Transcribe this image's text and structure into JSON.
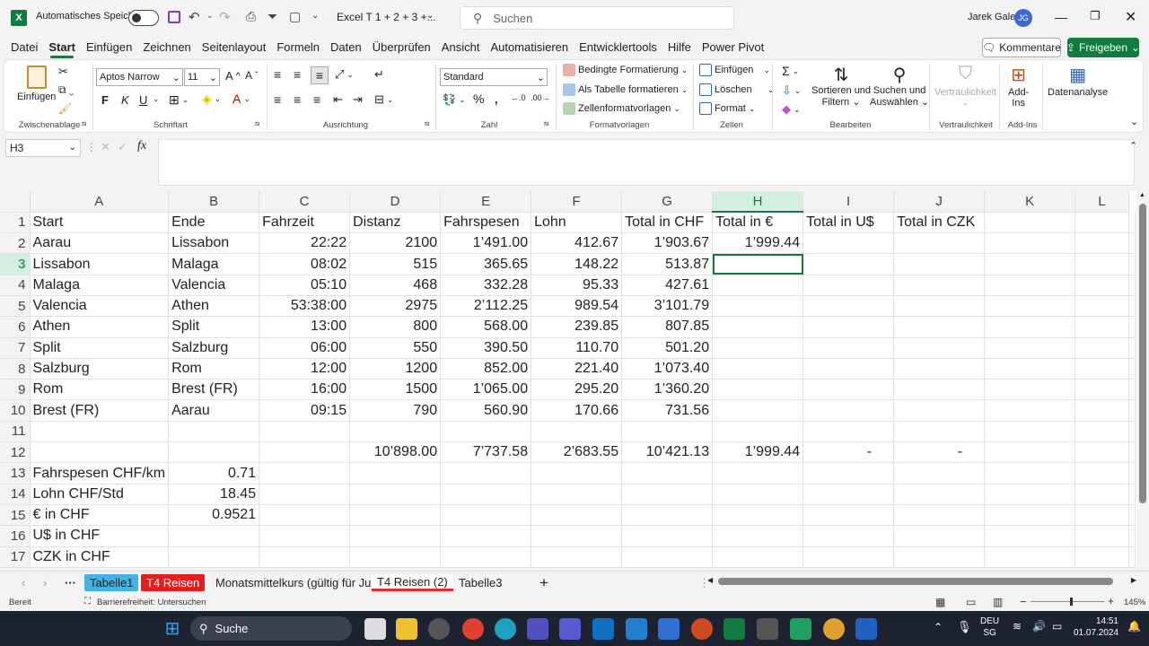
{
  "titlebar": {
    "autosave_label": "Automatisches Speichern",
    "filename": "Excel T 1 + 2 + 3 +...",
    "search_placeholder": "Suchen",
    "user_name": "Jarek Galek",
    "user_initials": "JG"
  },
  "menu": [
    "Datei",
    "Start",
    "Einfügen",
    "Zeichnen",
    "Seitenlayout",
    "Formeln",
    "Daten",
    "Überprüfen",
    "Ansicht",
    "Automatisieren",
    "Entwicklertools",
    "Hilfe",
    "Power Pivot"
  ],
  "buttons": {
    "kommentare": "Kommentare",
    "freigeben": "Freigeben"
  },
  "ribbon": {
    "clipboard": {
      "paste": "Einfügen",
      "label": "Zwischenablage"
    },
    "font": {
      "name": "Aptos Narrow",
      "size": "11",
      "label": "Schriftart",
      "bold": "F",
      "italic": "K",
      "underline": "U"
    },
    "alignment": {
      "label": "Ausrichtung"
    },
    "number": {
      "format": "Standard",
      "label": "Zahl"
    },
    "styles": {
      "cond": "Bedingte Formatierung",
      "table": "Als Tabelle formatieren",
      "cell": "Zellenformatvorlagen",
      "label": "Formatvorlagen"
    },
    "cells": {
      "insert": "Einfügen",
      "delete": "Löschen",
      "format": "Format",
      "label": "Zellen"
    },
    "editing": {
      "sort1": "Sortieren und",
      "sort2": "Filtern",
      "find1": "Suchen und",
      "find2": "Auswählen",
      "label": "Bearbeiten"
    },
    "sensitivity": {
      "btn": "Vertraulichkeit",
      "label": "Vertraulichkeit"
    },
    "addins": {
      "btn1": "Add-",
      "btn2": "Ins",
      "label": "Add-Ins"
    },
    "analysis": {
      "btn": "Datenanalyse"
    }
  },
  "formula_bar": {
    "name_box": "H3",
    "fx": "fx",
    "content": ""
  },
  "columns": [
    "A",
    "B",
    "C",
    "D",
    "E",
    "F",
    "G",
    "H",
    "I",
    "J",
    "K",
    "L"
  ],
  "rows": [
    [
      "Start",
      "Ende",
      "Fahrzeit",
      "Distanz",
      "Fahrspesen",
      "Lohn",
      "Total in CHF",
      "Total in €",
      "Total in U$",
      "Total in CZK",
      "",
      ""
    ],
    [
      "Aarau",
      "Lissabon",
      "22:22",
      "2100",
      "1’491.00",
      "412.67",
      "1’903.67",
      "1’999.44",
      "",
      "",
      "",
      ""
    ],
    [
      "Lissabon",
      "Malaga",
      "08:02",
      "515",
      "365.65",
      "148.22",
      "513.87",
      "",
      "",
      "",
      "",
      ""
    ],
    [
      "Malaga",
      "Valencia",
      "05:10",
      "468",
      "332.28",
      "95.33",
      "427.61",
      "",
      "",
      "",
      "",
      ""
    ],
    [
      "Valencia",
      "Athen",
      "53:38:00",
      "2975",
      "2’112.25",
      "989.54",
      "3’101.79",
      "",
      "",
      "",
      "",
      ""
    ],
    [
      "Athen",
      "Split",
      "13:00",
      "800",
      "568.00",
      "239.85",
      "807.85",
      "",
      "",
      "",
      "",
      ""
    ],
    [
      "Split",
      "Salzburg",
      "06:00",
      "550",
      "390.50",
      "110.70",
      "501.20",
      "",
      "",
      "",
      "",
      ""
    ],
    [
      "Salzburg",
      "Rom",
      "12:00",
      "1200",
      "852.00",
      "221.40",
      "1’073.40",
      "",
      "",
      "",
      "",
      ""
    ],
    [
      "Rom",
      "Brest (FR)",
      "16:00",
      "1500",
      "1’065.00",
      "295.20",
      "1’360.20",
      "",
      "",
      "",
      "",
      ""
    ],
    [
      "Brest (FR)",
      "Aarau",
      "09:15",
      "790",
      "560.90",
      "170.66",
      "731.56",
      "",
      "",
      "",
      "",
      ""
    ],
    [
      "",
      "",
      "",
      "",
      "",
      "",
      "",
      "",
      "",
      "",
      "",
      ""
    ],
    [
      "",
      "",
      "",
      "10’898.00",
      "7’737.58",
      "2’683.55",
      "10’421.13",
      "1’999.44",
      "-",
      "-",
      "",
      ""
    ],
    [
      "Fahrspesen CHF/km",
      "0.71",
      "",
      "",
      "",
      "",
      "",
      "",
      "",
      "",
      "",
      ""
    ],
    [
      "Lohn CHF/Std",
      "18.45",
      "",
      "",
      "",
      "",
      "",
      "",
      "",
      "",
      "",
      ""
    ],
    [
      "€ in CHF",
      "0.9521",
      "",
      "",
      "",
      "",
      "",
      "",
      "",
      "",
      "",
      ""
    ],
    [
      "U$ in CHF",
      "",
      "",
      "",
      "",
      "",
      "",
      "",
      "",
      "",
      "",
      ""
    ],
    [
      "CZK in CHF",
      "",
      "",
      "",
      "",
      "",
      "",
      "",
      "",
      "",
      "",
      ""
    ]
  ],
  "selected_cell": "H3",
  "sheets": [
    "Tabelle1",
    "T4 Reisen",
    "Monatsmittelkurs (gültig für Ju",
    "T4 Reisen (2)",
    "Tabelle3"
  ],
  "status": {
    "ready": "Bereit",
    "accessibility": "Barrierefreiheit: Untersuchen",
    "zoom": "145%"
  },
  "taskbar": {
    "search": "Suche",
    "lang1": "DEU",
    "lang2": "SG",
    "time": "14:51",
    "date": "01.07.2024"
  },
  "colors": {
    "excel_green": "#107c41",
    "selection_header": "#d3f0e0"
  }
}
